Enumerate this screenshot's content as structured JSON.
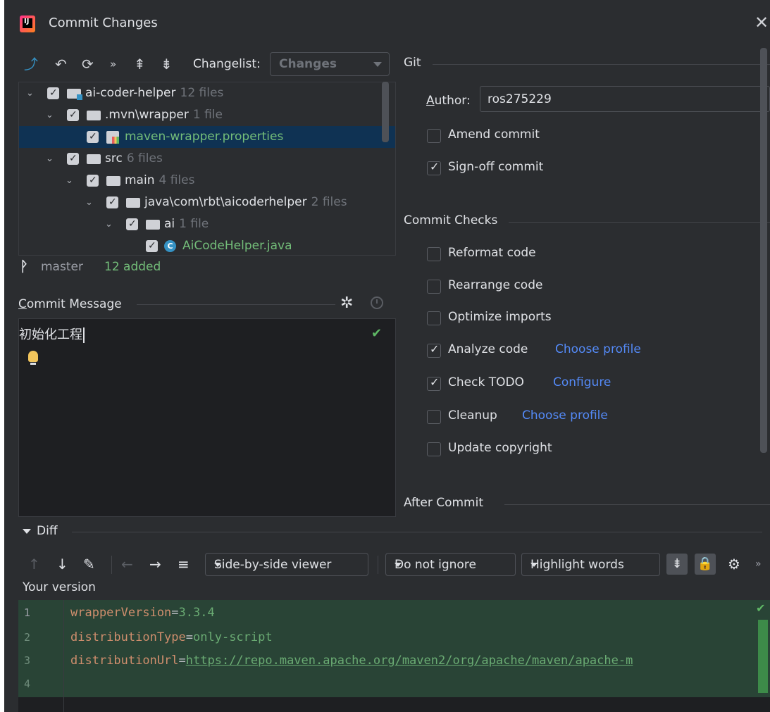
{
  "window": {
    "title": "Commit Changes",
    "close": "✕"
  },
  "toolbar": {
    "changelist_label": "Changelist:",
    "changelist_value": "Changes",
    "icons": [
      "rollback-arrow-icon",
      "undo-icon",
      "refresh-icon",
      "more-icon",
      "expand-all-icon",
      "collapse-all-icon"
    ]
  },
  "tree": {
    "rows": [
      {
        "name": "ai-coder-helper",
        "count": "12 files"
      },
      {
        "name": ".mvn\\wrapper",
        "count": "1 file"
      },
      {
        "name": "maven-wrapper.properties",
        "count": ""
      },
      {
        "name": "src",
        "count": "6 files"
      },
      {
        "name": "main",
        "count": "4 files"
      },
      {
        "name": "java\\com\\rbt\\aicoderhelper",
        "count": "2 files"
      },
      {
        "name": "ai",
        "count": "1 file"
      },
      {
        "name": "AiCodeHelper.java",
        "count": ""
      }
    ]
  },
  "branch": {
    "name": "master",
    "status": "12 added"
  },
  "commit_message": {
    "label": "Commit Message",
    "text": "初始化工程"
  },
  "git": {
    "section": "Git",
    "author_label": "Author:",
    "author_value": "ros275229",
    "amend": "Amend commit",
    "signoff": "Sign-off commit"
  },
  "checks": {
    "section": "Commit Checks",
    "reformat": "Reformat code",
    "rearrange": "Rearrange code",
    "optimize": "Optimize imports",
    "analyze": "Analyze code",
    "analyze_link": "Choose profile",
    "todo": "Check TODO",
    "todo_link": "Configure",
    "cleanup": "Cleanup",
    "cleanup_link": "Choose profile",
    "copyright": "Update copyright"
  },
  "after_commit": {
    "section": "After Commit"
  },
  "diff": {
    "label": "Diff",
    "viewer": "Side-by-side viewer",
    "ignore": "Do not ignore",
    "highlight": "Highlight words",
    "your_version": "Your version",
    "lines": [
      {
        "n": "1",
        "key": "wrapperVersion",
        "eq": "=",
        "val": "3.3.4"
      },
      {
        "n": "2",
        "key": "distributionType",
        "eq": "=",
        "val": "only-script"
      },
      {
        "n": "3",
        "key": "distributionUrl",
        "eq": "=",
        "val": "https://repo.maven.apache.org/maven2/org/apache/maven/apache-m"
      },
      {
        "n": "4",
        "key": "",
        "eq": "",
        "val": ""
      }
    ]
  },
  "colors": {
    "accent": "#3574f0",
    "link": "#548af7",
    "added": "#73bd79",
    "diff_bg": "#294436"
  }
}
